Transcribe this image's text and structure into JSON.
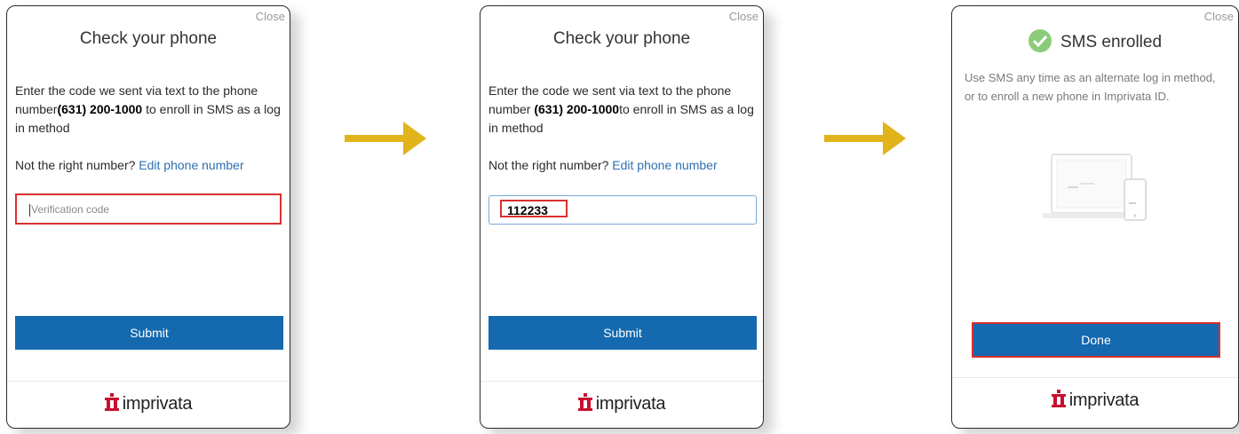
{
  "step1": {
    "close_label": "Close",
    "title": "Check your phone",
    "text_before": "Enter the code we sent via text to the phone number",
    "phone": "(631) 200-1000",
    "text_after": " to enroll in SMS as a log in method",
    "not_right": "Not the right number?",
    "edit_link": "Edit phone number",
    "input_placeholder": "Verification code",
    "submit_label": "Submit",
    "logo_text": "imprivata"
  },
  "step2": {
    "close_label": "Close",
    "title": "Check your phone",
    "text_before": "Enter the code we sent via text to the phone number ",
    "phone": "(631) 200-1000",
    "text_after": "to enroll in SMS as a log in method",
    "not_right": "Not the right number?",
    "edit_link": "Edit phone number",
    "input_value": "112233",
    "submit_label": "Submit",
    "logo_text": "imprivata"
  },
  "step3": {
    "close_label": "Close",
    "title": "SMS enrolled",
    "message": "Use SMS any time as an alternate log in method, or to enroll a new phone in Imprivata ID.",
    "done_label": "Done",
    "logo_text": "imprivata"
  },
  "colors": {
    "arrow": "#e2b41b",
    "button": "#1569ae",
    "highlight": "#d9302e",
    "link": "#2e6fb0",
    "success": "#8ccb7a",
    "logo_red": "#c8102e"
  }
}
